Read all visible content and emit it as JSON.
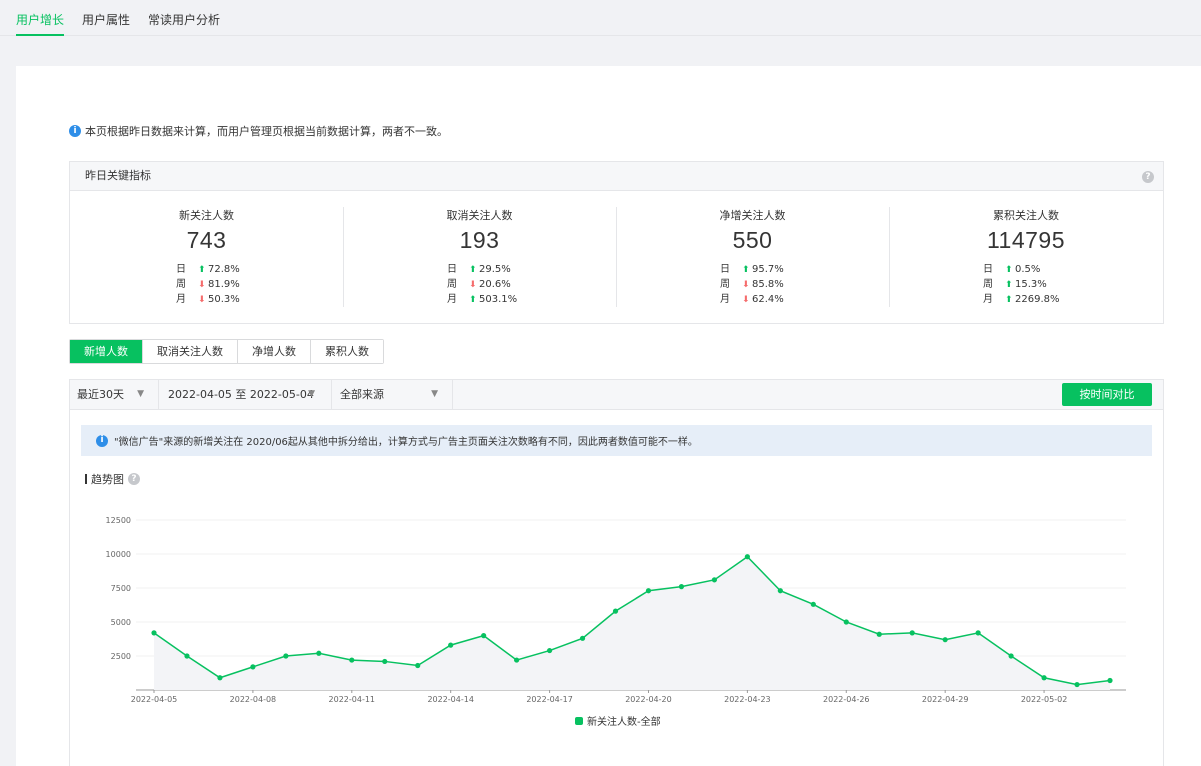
{
  "top_tabs": [
    "用户增长",
    "用户属性",
    "常读用户分析"
  ],
  "notice": "本页根据昨日数据来计算，而用户管理页根据当前数据计算，两者不一致。",
  "kpi": {
    "title": "昨日关键指标",
    "items": [
      {
        "title": "新关注人数",
        "value": "743",
        "rows": [
          {
            "label": "日",
            "dir": "up",
            "value": "72.8%"
          },
          {
            "label": "周",
            "dir": "down",
            "value": "81.9%"
          },
          {
            "label": "月",
            "dir": "down",
            "value": "50.3%"
          }
        ]
      },
      {
        "title": "取消关注人数",
        "value": "193",
        "rows": [
          {
            "label": "日",
            "dir": "up",
            "value": "29.5%"
          },
          {
            "label": "周",
            "dir": "down",
            "value": "20.6%"
          },
          {
            "label": "月",
            "dir": "up",
            "value": "503.1%"
          }
        ]
      },
      {
        "title": "净增关注人数",
        "value": "550",
        "rows": [
          {
            "label": "日",
            "dir": "up",
            "value": "95.7%"
          },
          {
            "label": "周",
            "dir": "down",
            "value": "85.8%"
          },
          {
            "label": "月",
            "dir": "down",
            "value": "62.4%"
          }
        ]
      },
      {
        "title": "累积关注人数",
        "value": "114795",
        "rows": [
          {
            "label": "日",
            "dir": "up",
            "value": "0.5%"
          },
          {
            "label": "周",
            "dir": "up",
            "value": "15.3%"
          },
          {
            "label": "月",
            "dir": "up",
            "value": "2269.8%"
          }
        ]
      }
    ]
  },
  "metric_tabs": [
    "新增人数",
    "取消关注人数",
    "净增人数",
    "累积人数"
  ],
  "filters": {
    "period": "最近30天",
    "date_range": "2022-04-05 至 2022-05-04",
    "source": "全部来源",
    "compare_button": "按时间对比"
  },
  "tip": "\"微信广告\"来源的新增关注在 2020/06起从其他中拆分给出，计算方式与广告主页面关注次数略有不同，因此两者数值可能不一样。",
  "trend_title": "趋势图",
  "colors": {
    "accent": "#07c160",
    "up": "#07c160",
    "down": "#f56c6c",
    "info": "#2e8ee8"
  },
  "chart_data": {
    "type": "area",
    "x": [
      "2022-04-05",
      "2022-04-06",
      "2022-04-07",
      "2022-04-08",
      "2022-04-09",
      "2022-04-10",
      "2022-04-11",
      "2022-04-12",
      "2022-04-13",
      "2022-04-14",
      "2022-04-15",
      "2022-04-16",
      "2022-04-17",
      "2022-04-18",
      "2022-04-19",
      "2022-04-20",
      "2022-04-21",
      "2022-04-22",
      "2022-04-23",
      "2022-04-24",
      "2022-04-25",
      "2022-04-26",
      "2022-04-27",
      "2022-04-28",
      "2022-04-29",
      "2022-04-30",
      "2022-05-01",
      "2022-05-02",
      "2022-05-03",
      "2022-05-04"
    ],
    "x_tick_labels": [
      "2022-04-05",
      "2022-04-08",
      "2022-04-11",
      "2022-04-14",
      "2022-04-17",
      "2022-04-20",
      "2022-04-23",
      "2022-04-26",
      "2022-04-29",
      "2022-05-02"
    ],
    "series": [
      {
        "name": "新关注人数-全部",
        "values": [
          4200,
          2500,
          900,
          1700,
          2500,
          2700,
          2200,
          2100,
          1800,
          3300,
          4000,
          2200,
          2900,
          3800,
          5800,
          7300,
          7600,
          8100,
          9800,
          7300,
          6300,
          5000,
          4100,
          4200,
          3700,
          4200,
          2500,
          900,
          400,
          700
        ]
      }
    ],
    "y_ticks": [
      2500,
      5000,
      7500,
      10000,
      12500
    ],
    "ylim": [
      0,
      12500
    ],
    "grid": true,
    "legend_position": "bottom-center"
  }
}
